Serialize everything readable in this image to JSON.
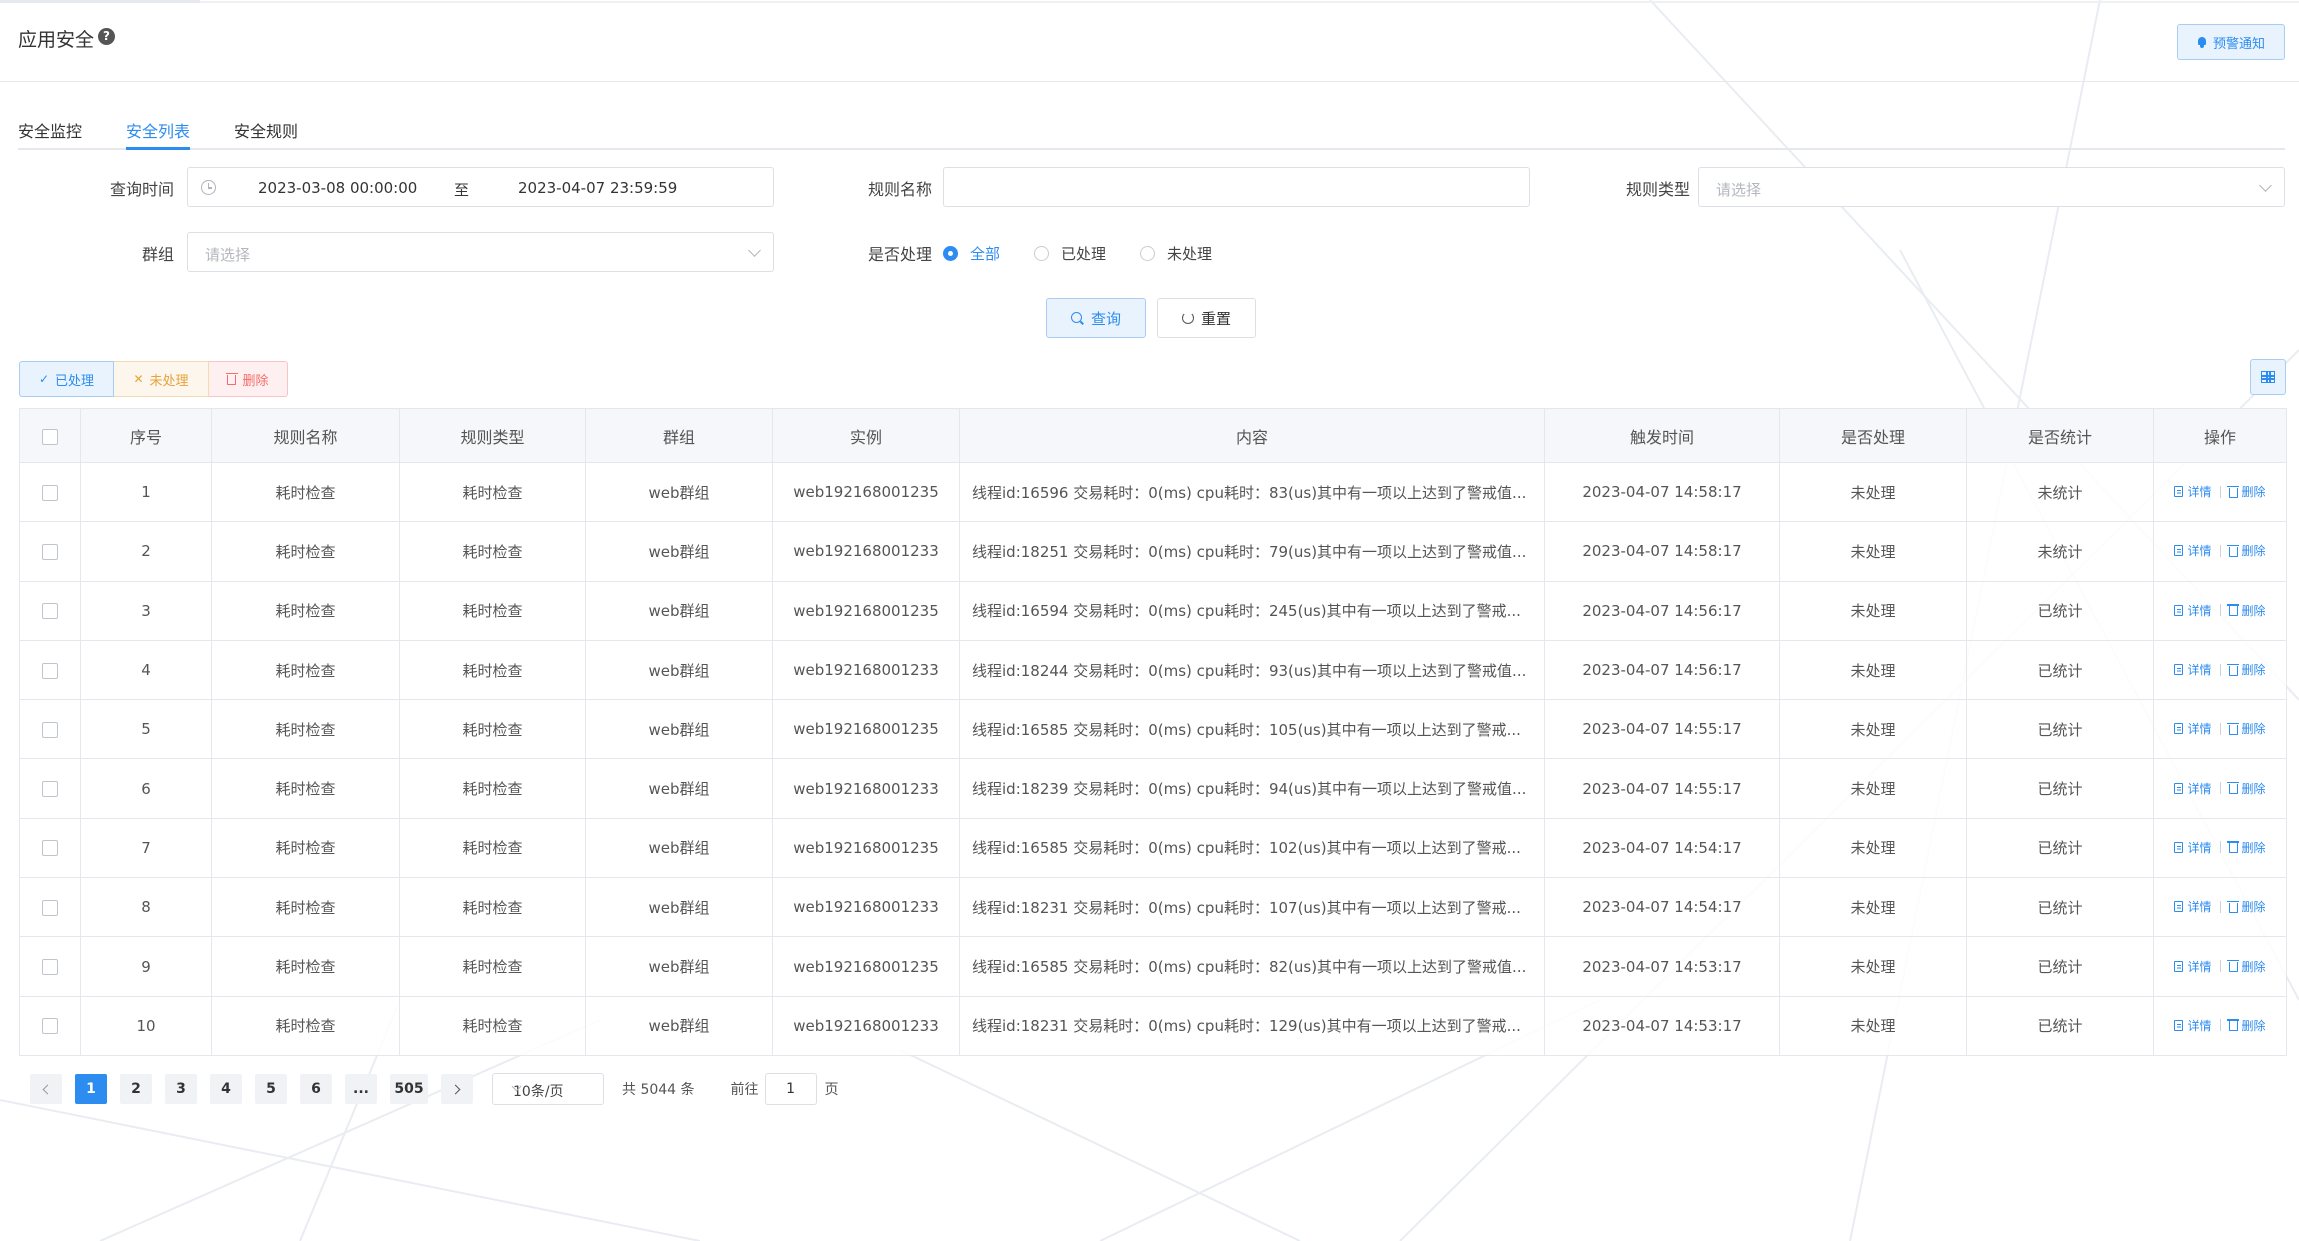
{
  "header": {
    "title": "应用安全",
    "help_icon": "question-circle-icon",
    "notify_button": "预警通知"
  },
  "tabs": [
    {
      "label": "安全监控",
      "active": false
    },
    {
      "label": "安全列表",
      "active": true
    },
    {
      "label": "安全规则",
      "active": false
    }
  ],
  "filters": {
    "query_time_label": "查询时间",
    "date_start": "2023-03-08 00:00:00",
    "date_sep": "至",
    "date_end": "2023-04-07 23:59:59",
    "rule_name_label": "规则名称",
    "rule_name_value": "",
    "rule_type_label": "规则类型",
    "rule_type_placeholder": "请选择",
    "group_label": "群组",
    "group_placeholder": "请选择",
    "processed_label": "是否处理",
    "processed_options": [
      "全部",
      "已处理",
      "未处理"
    ],
    "processed_selected": "全部",
    "query_button": "查询",
    "reset_button": "重置"
  },
  "actions": {
    "mark_done": "已处理",
    "mark_undone": "未处理",
    "delete": "删除"
  },
  "table": {
    "columns": [
      "序号",
      "规则名称",
      "规则类型",
      "群组",
      "实例",
      "内容",
      "触发时间",
      "是否处理",
      "是否统计",
      "操作"
    ],
    "op_detail": "详情",
    "op_delete": "删除",
    "rows": [
      {
        "no": "1",
        "rule_name": "耗时检查",
        "rule_type": "耗时检查",
        "group": "web群组",
        "instance": "web192168001235",
        "content": "线程id:16596 交易耗时：0(ms) cpu耗时：83(us)其中有一项以上达到了警戒值...",
        "time": "2023-04-07 14:58:17",
        "processed": "未处理",
        "counted": "未统计"
      },
      {
        "no": "2",
        "rule_name": "耗时检查",
        "rule_type": "耗时检查",
        "group": "web群组",
        "instance": "web192168001233",
        "content": "线程id:18251 交易耗时：0(ms) cpu耗时：79(us)其中有一项以上达到了警戒值...",
        "time": "2023-04-07 14:58:17",
        "processed": "未处理",
        "counted": "未统计"
      },
      {
        "no": "3",
        "rule_name": "耗时检查",
        "rule_type": "耗时检查",
        "group": "web群组",
        "instance": "web192168001235",
        "content": "线程id:16594 交易耗时：0(ms) cpu耗时：245(us)其中有一项以上达到了警戒...",
        "time": "2023-04-07 14:56:17",
        "processed": "未处理",
        "counted": "已统计"
      },
      {
        "no": "4",
        "rule_name": "耗时检查",
        "rule_type": "耗时检查",
        "group": "web群组",
        "instance": "web192168001233",
        "content": "线程id:18244 交易耗时：0(ms) cpu耗时：93(us)其中有一项以上达到了警戒值...",
        "time": "2023-04-07 14:56:17",
        "processed": "未处理",
        "counted": "已统计"
      },
      {
        "no": "5",
        "rule_name": "耗时检查",
        "rule_type": "耗时检查",
        "group": "web群组",
        "instance": "web192168001235",
        "content": "线程id:16585 交易耗时：0(ms) cpu耗时：105(us)其中有一项以上达到了警戒...",
        "time": "2023-04-07 14:55:17",
        "processed": "未处理",
        "counted": "已统计"
      },
      {
        "no": "6",
        "rule_name": "耗时检查",
        "rule_type": "耗时检查",
        "group": "web群组",
        "instance": "web192168001233",
        "content": "线程id:18239 交易耗时：0(ms) cpu耗时：94(us)其中有一项以上达到了警戒值...",
        "time": "2023-04-07 14:55:17",
        "processed": "未处理",
        "counted": "已统计"
      },
      {
        "no": "7",
        "rule_name": "耗时检查",
        "rule_type": "耗时检查",
        "group": "web群组",
        "instance": "web192168001235",
        "content": "线程id:16585 交易耗时：0(ms) cpu耗时：102(us)其中有一项以上达到了警戒...",
        "time": "2023-04-07 14:54:17",
        "processed": "未处理",
        "counted": "已统计"
      },
      {
        "no": "8",
        "rule_name": "耗时检查",
        "rule_type": "耗时检查",
        "group": "web群组",
        "instance": "web192168001233",
        "content": "线程id:18231 交易耗时：0(ms) cpu耗时：107(us)其中有一项以上达到了警戒...",
        "time": "2023-04-07 14:54:17",
        "processed": "未处理",
        "counted": "已统计"
      },
      {
        "no": "9",
        "rule_name": "耗时检查",
        "rule_type": "耗时检查",
        "group": "web群组",
        "instance": "web192168001235",
        "content": "线程id:16585 交易耗时：0(ms) cpu耗时：82(us)其中有一项以上达到了警戒值...",
        "time": "2023-04-07 14:53:17",
        "processed": "未处理",
        "counted": "已统计"
      },
      {
        "no": "10",
        "rule_name": "耗时检查",
        "rule_type": "耗时检查",
        "group": "web群组",
        "instance": "web192168001233",
        "content": "线程id:18231 交易耗时：0(ms) cpu耗时：129(us)其中有一项以上达到了警戒...",
        "time": "2023-04-07 14:53:17",
        "processed": "未处理",
        "counted": "已统计"
      }
    ]
  },
  "pagination": {
    "pages": [
      "1",
      "2",
      "3",
      "4",
      "5",
      "6",
      "...",
      "505"
    ],
    "current": "1",
    "page_size": "10条/页",
    "total": "共 5044 条",
    "goto_label": "前往",
    "goto_value": "1",
    "page_suffix": "页"
  },
  "colors": {
    "primary": "#2d8cf0",
    "warning": "#e6a23c",
    "danger": "#f56c6c"
  }
}
